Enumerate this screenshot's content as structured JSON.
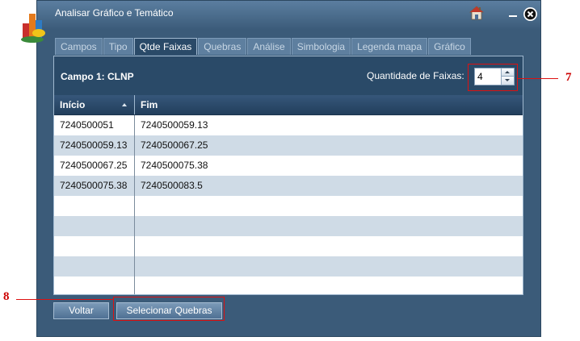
{
  "window": {
    "title": "Analisar Gráfico e Temático"
  },
  "tabs": [
    {
      "label": "Campos",
      "active": false
    },
    {
      "label": "Tipo",
      "active": false
    },
    {
      "label": "Qtde Faixas",
      "active": true
    },
    {
      "label": "Quebras",
      "active": false
    },
    {
      "label": "Análise",
      "active": false
    },
    {
      "label": "Simbologia",
      "active": false
    },
    {
      "label": "Legenda mapa",
      "active": false
    },
    {
      "label": "Gráfico",
      "active": false
    }
  ],
  "panel": {
    "campo_label": "Campo 1: CLNP",
    "quantity_label": "Quantidade de Faixas:",
    "quantity_value": "4"
  },
  "grid": {
    "columns": [
      "Início",
      "Fim"
    ],
    "rows": [
      [
        "7240500051",
        "7240500059.13"
      ],
      [
        "7240500059.13",
        "7240500067.25"
      ],
      [
        "7240500067.25",
        "7240500075.38"
      ],
      [
        "7240500075.38",
        "7240500083.5"
      ],
      [
        "",
        ""
      ],
      [
        "",
        ""
      ],
      [
        "",
        ""
      ],
      [
        "",
        ""
      ],
      [
        "",
        ""
      ]
    ]
  },
  "buttons": {
    "voltar": "Voltar",
    "selecionar_quebras": "Selecionar Quebras"
  },
  "annotations": {
    "callout_7": "7",
    "callout_8": "8"
  },
  "colors": {
    "window_bg": "#3b5b79",
    "panel_bg": "#2a4a68",
    "row_alt": "#cfdbe6",
    "highlight": "#dd1111"
  },
  "icons": [
    "app-icon",
    "home-icon",
    "minimize-icon",
    "close-icon",
    "sort-ascending-icon",
    "chevron-up-icon",
    "chevron-down-icon"
  ]
}
